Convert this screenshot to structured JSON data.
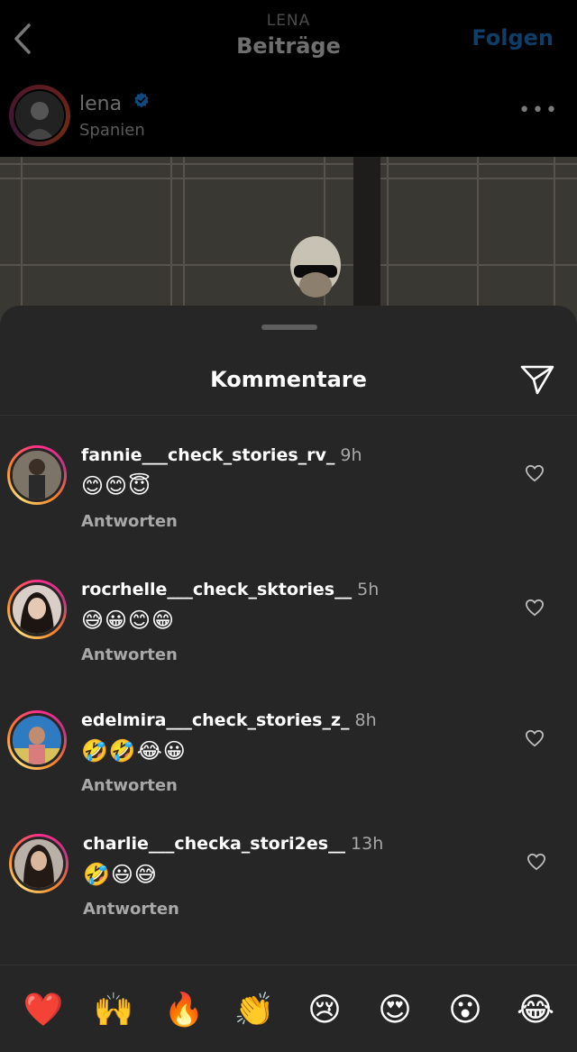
{
  "nav": {
    "username": "LENA",
    "title": "Beiträge",
    "follow_label": "Folgen"
  },
  "post": {
    "username": "lena",
    "location": "Spanien",
    "more_label": "•••"
  },
  "sheet": {
    "title": "Kommentare"
  },
  "comments": [
    {
      "user": "fannie___check_stories_rv_",
      "time": "9h",
      "text": "😊😊😇",
      "reply_label": "Antworten"
    },
    {
      "user": "rocrhelle___check_sktories__",
      "time": "5h",
      "text": "😅😀😊😁",
      "reply_label": "Antworten"
    },
    {
      "user": "edelmira___check_stories_z_",
      "time": "8h",
      "text": "🤣🤣😂😀",
      "reply_label": "Antworten"
    },
    {
      "user": "charlie___checka_stori2es__",
      "time": "13h",
      "text": "🤣😃😅",
      "reply_label": "Antworten"
    }
  ],
  "quick_reactions": [
    "❤️",
    "🙌",
    "🔥",
    "👏",
    "😢",
    "😍",
    "😮",
    "😂"
  ],
  "colors": {
    "accent": "#0095f6",
    "sheet_bg": "#262626",
    "secondary_text": "#a8a8a8"
  },
  "icons": {
    "back": "chevron-left-icon",
    "verified": "verified-badge-icon",
    "share": "paper-plane-icon",
    "like": "heart-outline-icon"
  }
}
